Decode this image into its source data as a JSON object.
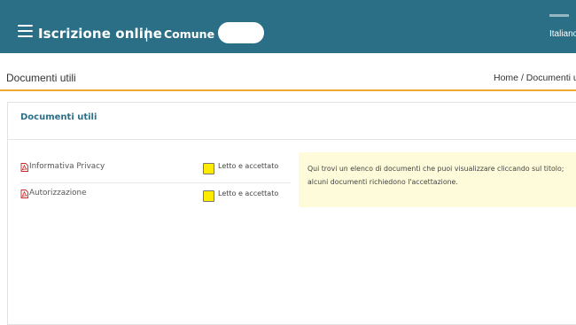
{
  "header": {
    "app_title": "Iscrizione online",
    "separator": "|",
    "comune_label": "Comune di",
    "language": "Italiano"
  },
  "page": {
    "title": "Documenti utili",
    "breadcrumb": {
      "home": "Home",
      "separator": "/",
      "current": "Documenti u"
    }
  },
  "panel": {
    "title": "Documenti utili",
    "documents": [
      {
        "label": "Informativa Privacy",
        "icon": "pdf-icon",
        "checkbox_label": "Letto e accettato",
        "checkbox_color": "#ffeb00"
      },
      {
        "label": "Autorizzazione",
        "icon": "pdf-icon",
        "checkbox_label": "Letto e accettato",
        "checkbox_color": "#ffeb00"
      }
    ],
    "info_text": "Qui trovi un elenco di documenti che puoi visualizzare cliccando sul titolo; alcuni documenti richiedono l'accettazione."
  },
  "colors": {
    "header_bg": "#2b6f86",
    "accent": "#f0a830",
    "info_bg": "#fdfbd9",
    "checkbox": "#ffeb00"
  }
}
